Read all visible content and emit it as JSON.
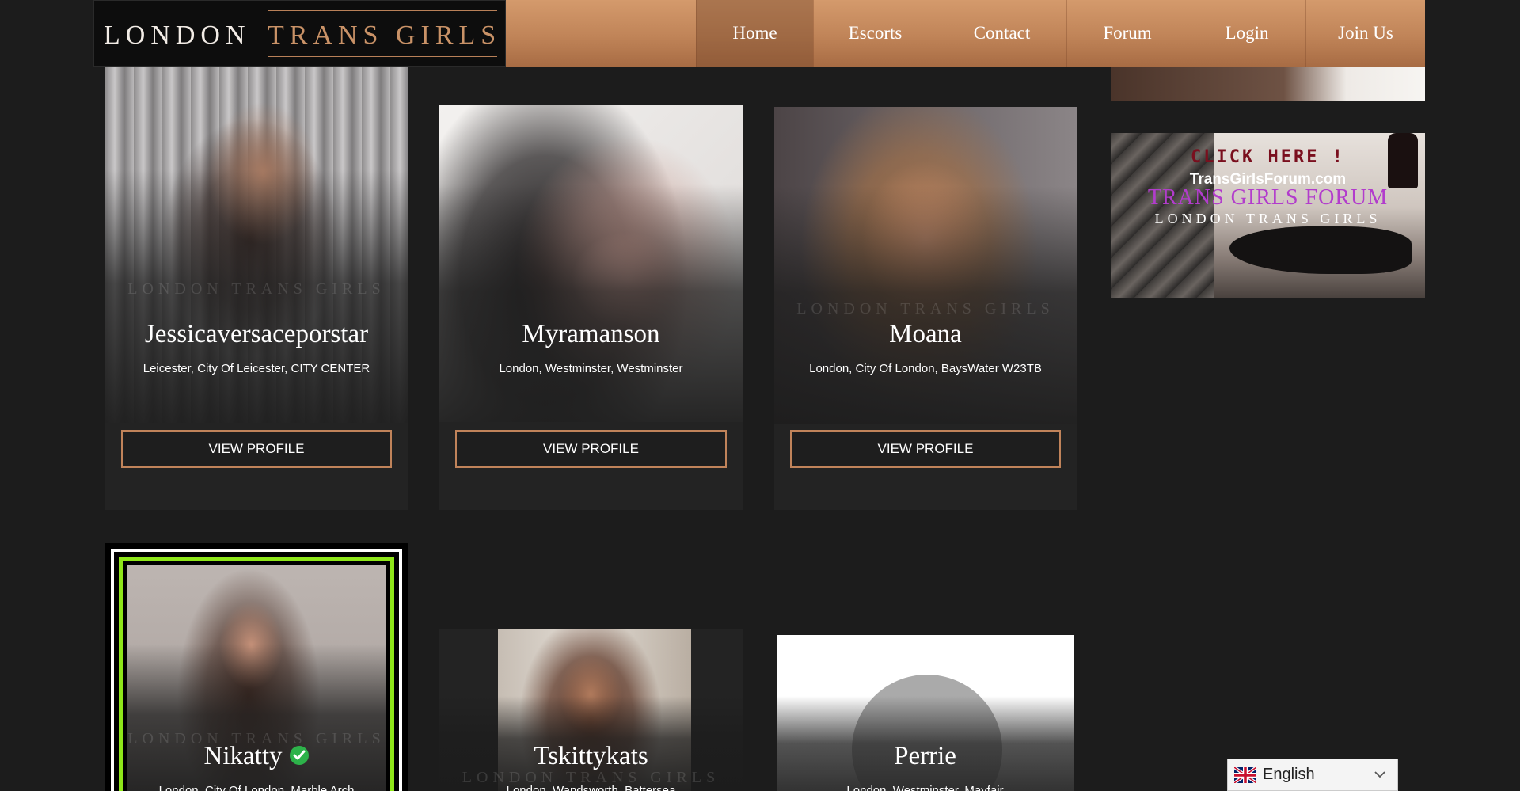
{
  "logo": {
    "part1": "LONDON",
    "part2": "TRANS GIRLS"
  },
  "nav": [
    {
      "label": "Home",
      "active": true
    },
    {
      "label": "Escorts",
      "active": false
    },
    {
      "label": "Contact",
      "active": false
    },
    {
      "label": "Forum",
      "active": false
    },
    {
      "label": "Login",
      "active": false
    },
    {
      "label": "Join Us",
      "active": false
    }
  ],
  "cards": [
    {
      "name": "Jessicaversaceporstar",
      "location": "Leicester, City Of Leicester, CITY CENTER",
      "button": "VIEW PROFILE",
      "watermark": "LONDON TRANS GIRLS"
    },
    {
      "name": "Myramanson",
      "location": "London, Westminster, Westminster",
      "button": "VIEW PROFILE",
      "watermark": ""
    },
    {
      "name": "Moana",
      "location": "London, City Of London, BaysWater W23TB",
      "button": "VIEW PROFILE",
      "watermark": "LONDON TRANS GIRLS"
    },
    {
      "name": "Nikatty",
      "location": "London, City Of London, Marble Arch",
      "verified": true,
      "watermark": "LONDON TRANS GIRLS"
    },
    {
      "name": "Tskittykats",
      "location": "London, Wandsworth, Battersea",
      "watermark": "LONDON TRANS GIRLS"
    },
    {
      "name": "Perrie",
      "location": "London, Westminster, Mayfair",
      "watermark": ""
    }
  ],
  "banner": {
    "click": "CLICK HERE !",
    "site": "TransGirlsForum.com",
    "forum": "TRANS GIRLS FORUM",
    "brand": "LONDON TRANS GIRLS"
  },
  "language": {
    "label": "English"
  },
  "colors": {
    "accent": "#c0835a",
    "background": "#1c1c1c",
    "header": "#c08458",
    "verified": "#2db24a",
    "neon_frame": "#8ee619"
  }
}
